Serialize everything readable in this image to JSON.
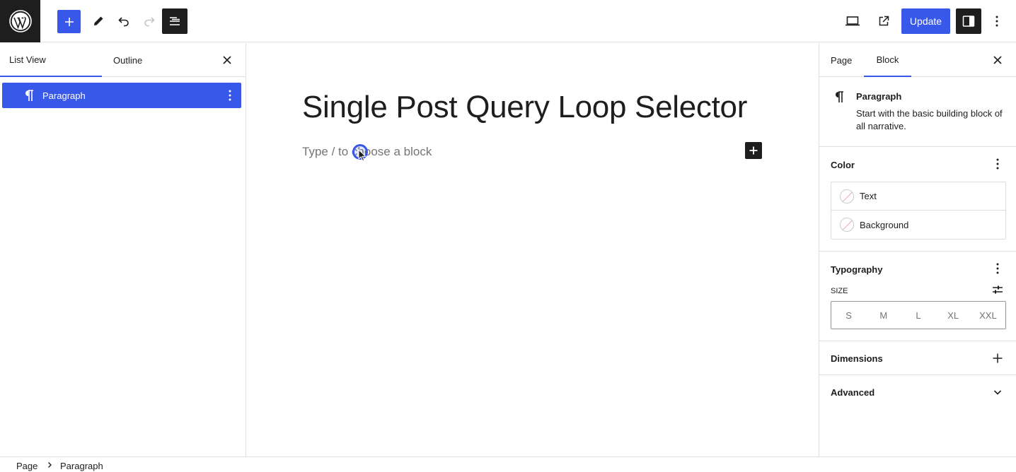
{
  "toolbar": {
    "add_block_icon": "plus-icon",
    "tools_icon": "pencil-icon",
    "undo_icon": "undo-icon",
    "redo_icon": "redo-icon",
    "document_overview_icon": "list-view-icon",
    "view_icon": "desktop-icon",
    "preview_icon": "external-link-icon",
    "update_label": "Update",
    "settings_icon": "sidebar-icon",
    "options_icon": "more-vertical-icon",
    "accent_color": "#3858e9"
  },
  "left_panel": {
    "tabs": [
      {
        "label": "List View",
        "active": true
      },
      {
        "label": "Outline",
        "active": false
      }
    ],
    "items": [
      {
        "label": "Paragraph",
        "selected": true
      }
    ]
  },
  "canvas": {
    "title": "Single Post Query Loop Selector",
    "placeholder": "Type / to choose a block"
  },
  "right_panel": {
    "tabs": [
      {
        "label": "Page",
        "active": false
      },
      {
        "label": "Block",
        "active": true
      }
    ],
    "block": {
      "name": "Paragraph",
      "description": "Start with the basic building block of all narrative."
    },
    "color": {
      "title": "Color",
      "items": [
        "Text",
        "Background"
      ]
    },
    "typography": {
      "title": "Typography",
      "size_label": "SIZE",
      "sizes": [
        "S",
        "M",
        "L",
        "XL",
        "XXL"
      ]
    },
    "dimensions": {
      "title": "Dimensions"
    },
    "advanced": {
      "title": "Advanced"
    }
  },
  "breadcrumb": [
    "Page",
    "Paragraph"
  ]
}
